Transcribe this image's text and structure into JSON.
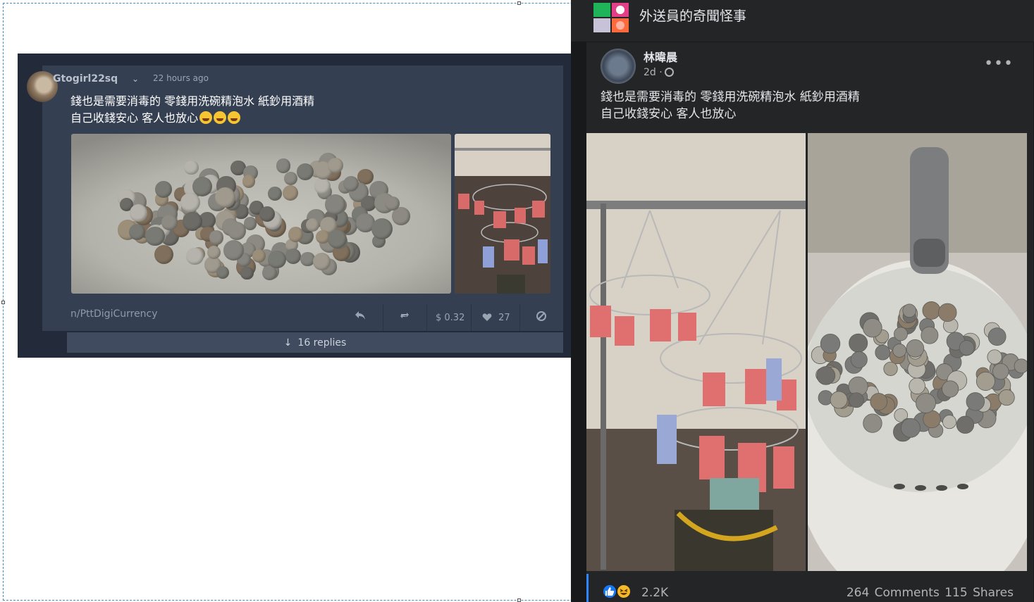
{
  "left_post": {
    "username": "Gtogirl22sq",
    "time": "22 hours ago",
    "text_line1": "錢也是需要消毒的 零錢用洗碗精泡水 紙鈔用酒精",
    "text_line2": "自己收錢安心 客人也放心",
    "community": "n/PttDigiCurrency",
    "tip_amount": "$ 0.32",
    "likes": "27",
    "replies": "16 replies"
  },
  "right_post": {
    "group_title": "外送員的奇聞怪事",
    "author": "林暐晨",
    "time": "2d ·",
    "text_line1": "錢也是需要消毒的 零錢用洗碗精泡水 紙鈔用酒精",
    "text_line2": "自己收錢安心 客人也放心",
    "reaction_count": "2.2K",
    "comments": "264 Comments",
    "shares": "115 Shares"
  },
  "colors": {
    "left_bg": "#232b3b",
    "left_card": "#353f52",
    "fb_bg": "#18191a",
    "fb_card": "#242526",
    "like_blue": "#1877f2",
    "haha_yellow": "#f7b928"
  }
}
